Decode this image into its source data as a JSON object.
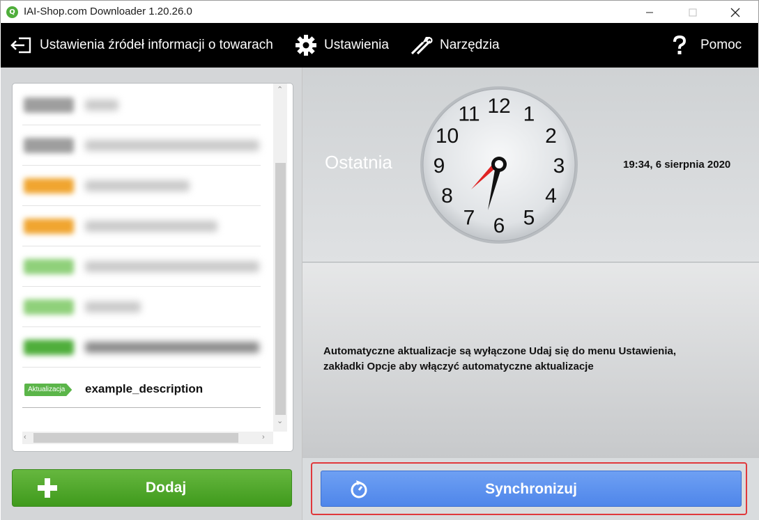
{
  "window": {
    "title": "IAI-Shop.com Downloader 1.20.26.0",
    "app_icon_glyph": "Q"
  },
  "menu": {
    "items": [
      {
        "label": "Ustawienia źródeł informacji o towarach",
        "icon": "sign-out-icon"
      },
      {
        "label": "Ustawienia",
        "icon": "gear-icon"
      },
      {
        "label": "Narzędzia",
        "icon": "tools-icon"
      },
      {
        "label": "Pomoc",
        "icon": "question-icon"
      }
    ]
  },
  "list": {
    "rows": [
      {
        "badge_color": "#9e9e9e",
        "blurred": true
      },
      {
        "badge_color": "#9e9e9e",
        "blurred": true
      },
      {
        "badge_color": "#f0a530",
        "blurred": true
      },
      {
        "badge_color": "#f0a530",
        "blurred": true
      },
      {
        "badge_color": "#8fd07a",
        "blurred": true
      },
      {
        "badge_color": "#8fd07a",
        "blurred": true
      },
      {
        "badge_color": "#4fae3b",
        "blurred": true
      }
    ],
    "highlight_row": {
      "tag": "Aktualizacja",
      "description": "example_description"
    }
  },
  "add_button": {
    "label": "Dodaj"
  },
  "clock_panel": {
    "label": "Ostatnia",
    "last_sync": "19:34, 6 sierpnia 2020",
    "clock_numbers": [
      "12",
      "1",
      "2",
      "3",
      "4",
      "5",
      "6",
      "7",
      "8",
      "9",
      "10",
      "11"
    ]
  },
  "info": {
    "line1": "Automatyczne aktualizacje są wyłączone Udaj się do menu Ustawienia,",
    "line2": "zakładki Opcje aby włączyć automatyczne aktualizacje"
  },
  "sync_button": {
    "label": "Synchronizuj"
  },
  "colors": {
    "menubar": "#000000",
    "add_button": "#4fa62a",
    "sync_button": "#5a8ff0",
    "highlight_border": "#e0383b"
  }
}
